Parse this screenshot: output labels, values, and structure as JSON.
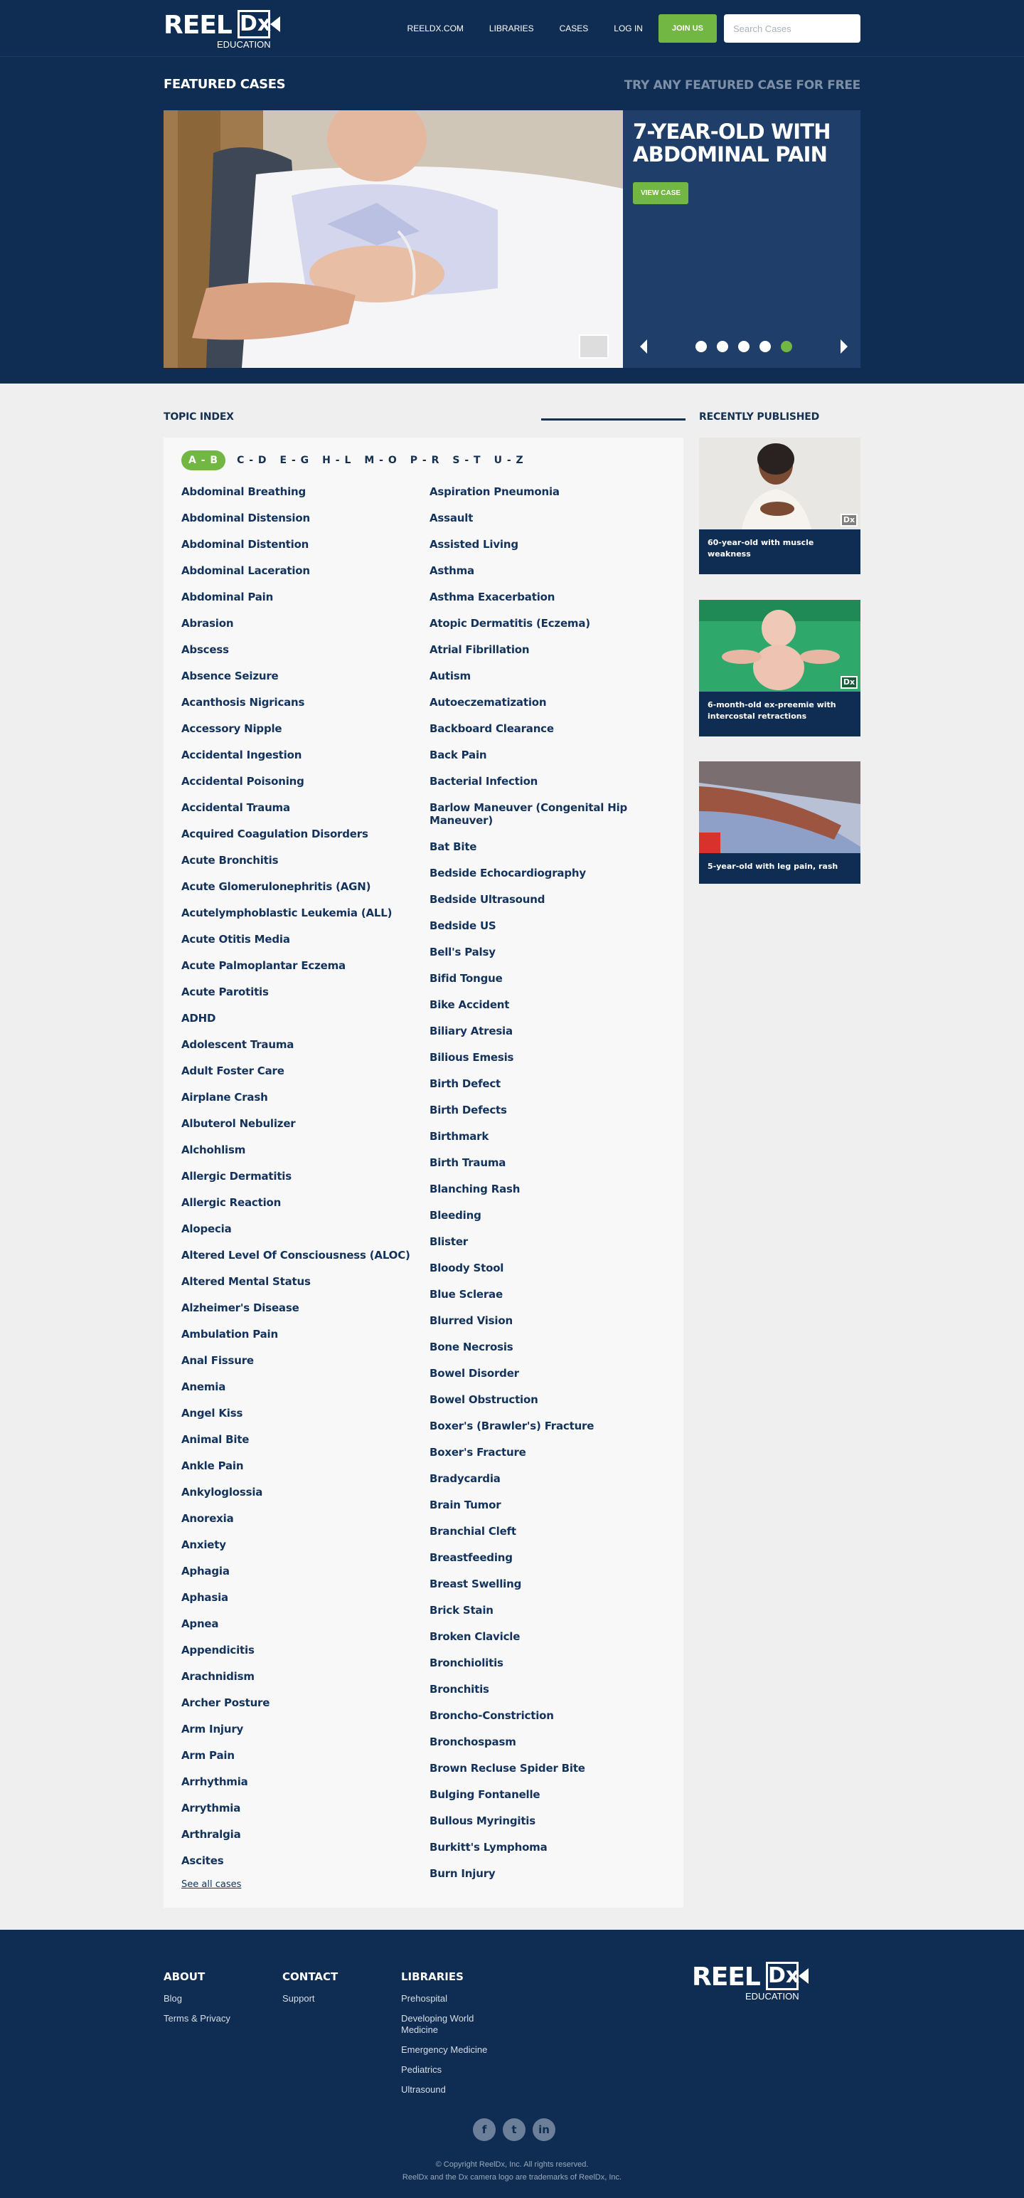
{
  "header": {
    "logo_text": "REEL",
    "logo_box": "Dx",
    "logo_sub": "EDUCATION",
    "nav": [
      "REELDX.COM",
      "LIBRARIES",
      "CASES",
      "LOG IN"
    ],
    "join_label": "JOIN US",
    "search_placeholder": "Search Cases"
  },
  "featured": {
    "title": "FEATURED CASES",
    "free_label": "TRY ANY FEATURED CASE FOR FREE",
    "case_title": "7-YEAR-OLD WITH ABDOMINAL PAIN",
    "view_label": "VIEW CASE",
    "slide_count": 5,
    "active_slide": 5
  },
  "topic_index": {
    "title": "TOPIC INDEX",
    "letters": [
      "A - B",
      "C - D",
      "E - G",
      "H - L",
      "M - O",
      "P - R",
      "S - T",
      "U - Z"
    ],
    "active_letter": "A - B",
    "col1": [
      "Abdominal Breathing",
      "Abdominal Distension",
      "Abdominal Distention",
      "Abdominal Laceration",
      "Abdominal Pain",
      "Abrasion",
      "Abscess",
      "Absence Seizure",
      "Acanthosis Nigricans",
      "Accessory Nipple",
      "Accidental Ingestion",
      "Accidental Poisoning",
      "Accidental Trauma",
      "Acquired Coagulation Disorders",
      "Acute Bronchitis",
      "Acute Glomerulonephritis (AGN)",
      "Acutelymphoblastic Leukemia (ALL)",
      "Acute Otitis Media",
      "Acute Palmoplantar Eczema",
      "Acute Parotitis",
      "ADHD",
      "Adolescent Trauma",
      "Adult Foster Care",
      "Airplane Crash",
      "Albuterol Nebulizer",
      "Alchohlism",
      "Allergic Dermatitis",
      "Allergic Reaction",
      "Alopecia",
      "Altered Level Of Consciousness (ALOC)",
      "Altered Mental Status",
      "Alzheimer's Disease",
      "Ambulation Pain",
      "Anal Fissure",
      "Anemia",
      "Angel Kiss",
      "Animal Bite",
      "Ankle Pain",
      "Ankyloglossia",
      "Anorexia",
      "Anxiety",
      "Aphagia",
      "Aphasia",
      "Apnea",
      "Appendicitis",
      "Arachnidism",
      "Archer Posture",
      "Arm Injury",
      "Arm Pain",
      "Arrhythmia",
      "Arrythmia",
      "Arthralgia",
      "Ascites"
    ],
    "col2": [
      "Aspiration Pneumonia",
      "Assault",
      "Assisted Living",
      "Asthma",
      "Asthma Exacerbation",
      "Atopic Dermatitis (Eczema)",
      "Atrial Fibrillation",
      "Autism",
      "Autoeczematization",
      "Backboard Clearance",
      "Back Pain",
      "Bacterial Infection",
      "Barlow Maneuver (Congenital Hip Maneuver)",
      "Bat Bite",
      "Bedside Echocardiography",
      "Bedside Ultrasound",
      "Bedside US",
      "Bell's Palsy",
      "Bifid Tongue",
      "Bike Accident",
      "Biliary Atresia",
      "Bilious Emesis",
      "Birth Defect",
      "Birth Defects",
      "Birthmark",
      "Birth Trauma",
      "Blanching Rash",
      "Bleeding",
      "Blister",
      "Bloody Stool",
      "Blue Sclerae",
      "Blurred Vision",
      "Bone Necrosis",
      "Bowel Disorder",
      "Bowel Obstruction",
      "Boxer's (Brawler's) Fracture",
      "Boxer's Fracture",
      "Bradycardia",
      "Brain Tumor",
      "Branchial Cleft",
      "Breastfeeding",
      "Breast Swelling",
      "Brick Stain",
      "Broken Clavicle",
      "Bronchiolitis",
      "Bronchitis",
      "Broncho-Constriction",
      "Bronchospasm",
      "Brown Recluse Spider Bite",
      "Bulging Fontanelle",
      "Bullous Myringitis",
      "Burkitt's Lymphoma",
      "Burn Injury"
    ],
    "see_all": "See all cases"
  },
  "recent": {
    "title": "RECENTLY PUBLISHED",
    "cards": [
      {
        "caption": "60-year-old with muscle weakness"
      },
      {
        "caption": "6-month-old ex-preemie with intercostal retractions"
      },
      {
        "caption": "5-year-old with leg pain, rash"
      }
    ]
  },
  "footer": {
    "about": {
      "title": "ABOUT",
      "links": [
        "Blog",
        "Terms & Privacy"
      ]
    },
    "contact": {
      "title": "CONTACT",
      "links": [
        "Support"
      ]
    },
    "libraries": {
      "title": "LIBRARIES",
      "links": [
        "Prehospital",
        "Developing World Medicine",
        "Emergency Medicine",
        "Pediatrics",
        "Ultrasound"
      ]
    },
    "social": [
      "f",
      "t",
      "in"
    ],
    "copyright": "© Copyright ReelDx, Inc. All rights reserved.",
    "trademark": "ReelDx and the Dx camera logo are trademarks of ReelDx, Inc."
  },
  "colors": {
    "navy": "#0f2d52",
    "green": "#72b643",
    "panel": "#1f3f6a"
  }
}
